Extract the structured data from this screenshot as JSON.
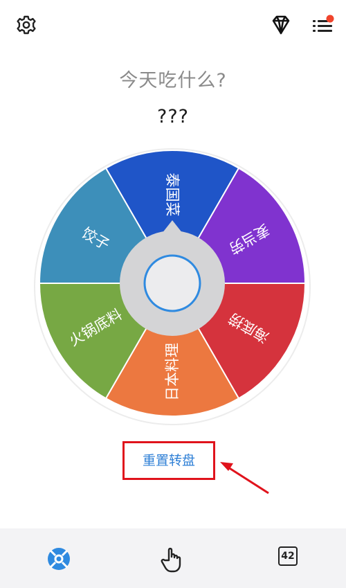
{
  "top_bar": {
    "settings_icon": "gear-icon",
    "premium_icon": "diamond-icon",
    "menu_icon": "list-icon",
    "notification_dot_color": "#f0442c"
  },
  "prompt": {
    "question": "今天吃什么?",
    "result": "???"
  },
  "wheel": {
    "segments": [
      {
        "label": "泰国菜",
        "color": "#1f55c8"
      },
      {
        "label": "麦当劳",
        "color": "#8033cf"
      },
      {
        "label": "海底捞",
        "color": "#d5333d"
      },
      {
        "label": "日本料理",
        "color": "#ec7840"
      },
      {
        "label": "火锅底料",
        "color": "#77a844"
      },
      {
        "label": "饺子",
        "color": "#3d8fba"
      }
    ],
    "hub_ring_color": "#2f8ae0",
    "spin_button_icon": "spin-button-circle"
  },
  "actions": {
    "reset_label": "重置转盘",
    "reset_color": "#2e7fd6",
    "annotation_color": "#e0131c"
  },
  "bottom_nav": {
    "items": [
      {
        "name": "wheel",
        "icon": "lifebuoy-icon",
        "active": true,
        "color": "#2f8ae0"
      },
      {
        "name": "tap",
        "icon": "pointer-hand-icon",
        "active": false
      },
      {
        "name": "count",
        "icon": "counter-icon",
        "value": "42",
        "active": false
      }
    ]
  }
}
